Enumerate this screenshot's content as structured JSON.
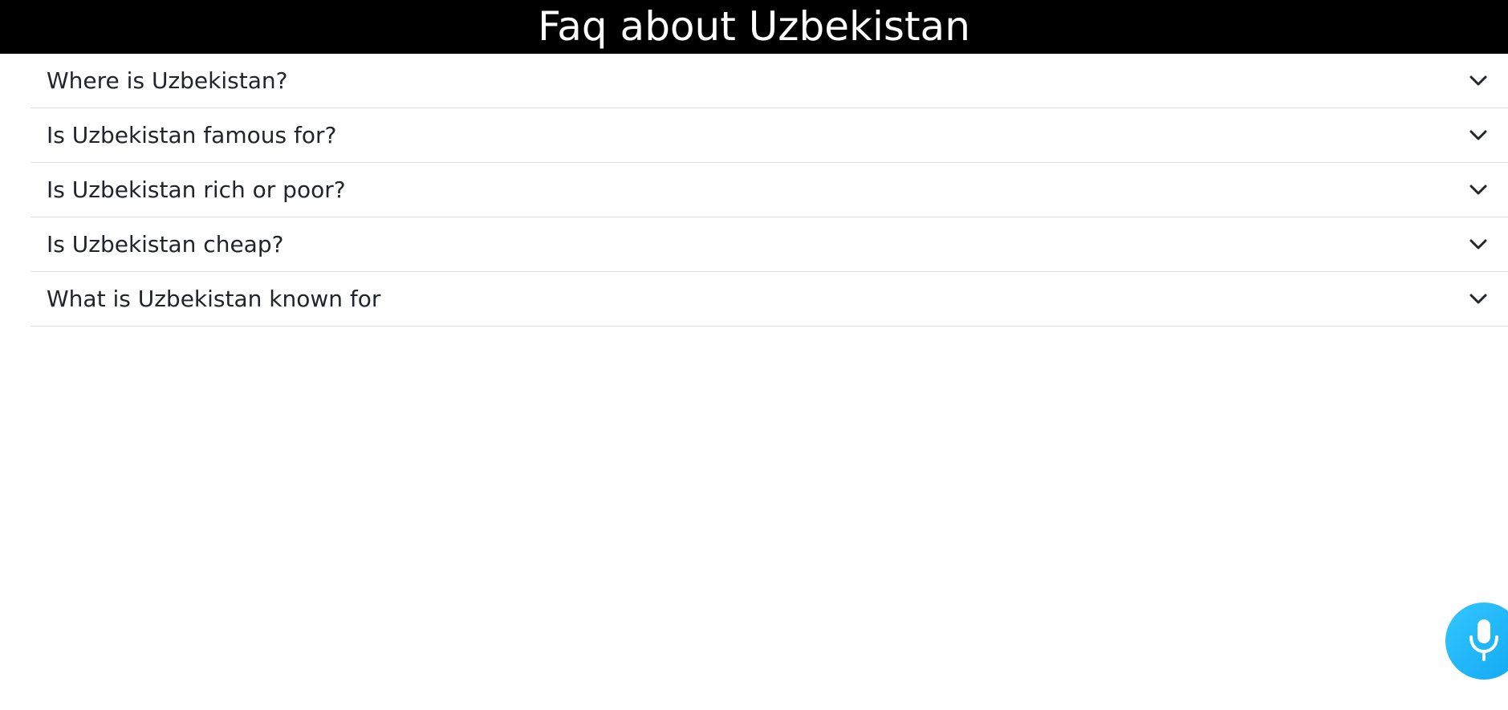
{
  "header": {
    "title": "Faq about Uzbekistan"
  },
  "faq": {
    "items": [
      {
        "question": "Where is Uzbekistan?"
      },
      {
        "question": "Is Uzbekistan famous for?"
      },
      {
        "question": "Is Uzbekistan rich or poor?"
      },
      {
        "question": "Is Uzbekistan cheap?"
      },
      {
        "question": "What is Uzbekistan known for"
      }
    ],
    "toggle_icon": "chevron-down-icon"
  },
  "voice": {
    "icon": "microphone-icon",
    "accent_color": "#1fb4f7"
  },
  "colors": {
    "header_bg": "#000000",
    "header_text": "#ffffff",
    "question_text": "#212529",
    "divider": "#dee2e6"
  }
}
